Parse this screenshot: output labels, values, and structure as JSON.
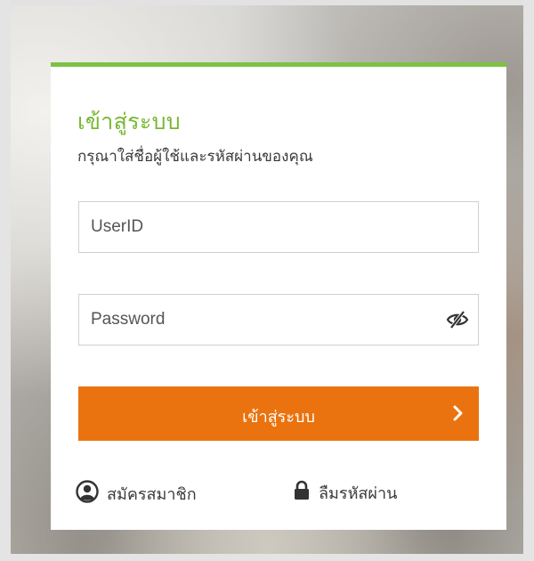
{
  "login": {
    "title": "เข้าสู่ระบบ",
    "subtitle": "กรุณาใส่ชื่อผู้ใช้และรหัสผ่านของคุณ",
    "user_placeholder": "UserID",
    "password_placeholder": "Password",
    "submit_label": "เข้าสู่ระบบ",
    "register_label": "สมัครสมาชิก",
    "forgot_label": "ลืมรหัสผ่าน"
  },
  "colors": {
    "accent_green": "#7cc242",
    "button_orange": "#ea730f"
  },
  "icons": {
    "password_toggle": "eye-slash-icon",
    "submit_arrow": "chevron-right-icon",
    "register": "user-circle-icon",
    "forgot": "lock-icon"
  }
}
